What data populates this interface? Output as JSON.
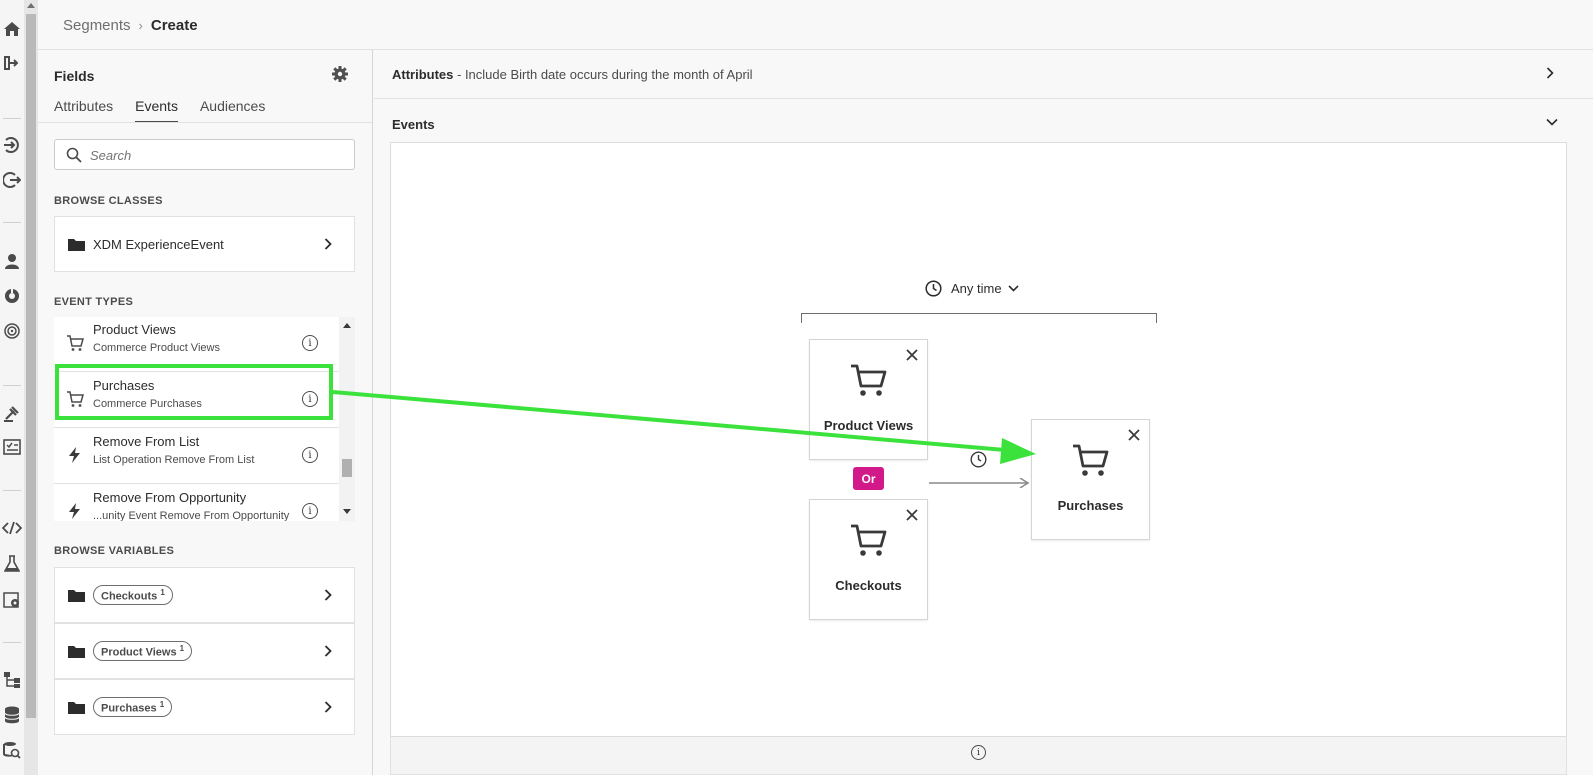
{
  "breadcrumb": {
    "parent": "Segments",
    "separator": "›",
    "current": "Create"
  },
  "fields_panel": {
    "title": "Fields",
    "tabs": [
      {
        "label": "Attributes",
        "active": false
      },
      {
        "label": "Events",
        "active": true
      },
      {
        "label": "Audiences",
        "active": false
      }
    ],
    "search": {
      "placeholder": "Search",
      "value": ""
    },
    "browse_classes": {
      "heading": "BROWSE CLASSES",
      "items": [
        {
          "label": "XDM ExperienceEvent",
          "icon": "folder-icon"
        }
      ]
    },
    "event_types": {
      "heading": "EVENT TYPES",
      "items": [
        {
          "title": "Product Views",
          "subtitle": "Commerce Product Views",
          "icon": "cart-icon"
        },
        {
          "title": "Purchases",
          "subtitle": "Commerce Purchases",
          "icon": "cart-icon"
        },
        {
          "title": "Remove From List",
          "subtitle": "List Operation Remove From List",
          "icon": "lightning-icon"
        },
        {
          "title": "Remove From Opportunity",
          "subtitle": "...unity Event Remove From Opportunity",
          "icon": "lightning-icon"
        }
      ]
    },
    "browse_variables": {
      "heading": "BROWSE VARIABLES",
      "items": [
        {
          "label": "Checkouts",
          "count": "1"
        },
        {
          "label": "Product Views",
          "count": "1"
        },
        {
          "label": "Purchases",
          "count": "1"
        }
      ]
    }
  },
  "attributes_bar": {
    "label": "Attributes",
    "description": " - Include Birth date occurs during the month of April"
  },
  "events_section": {
    "label": "Events",
    "time_selector": "Any time",
    "or_badge": "Or",
    "cards": [
      {
        "label": "Product Views"
      },
      {
        "label": "Checkouts"
      },
      {
        "label": "Purchases"
      }
    ]
  },
  "colors": {
    "highlight": "#3ce23c",
    "or_badge": "#d1198a"
  }
}
